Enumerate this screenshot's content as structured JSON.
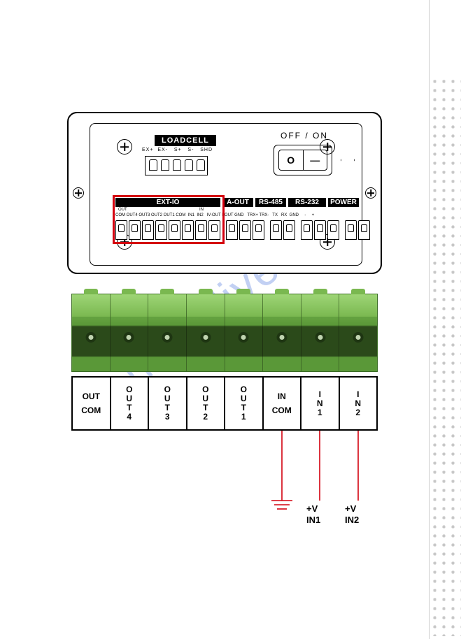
{
  "watermark": "manualslive.com",
  "device": {
    "loadcell_label": "LOADCELL",
    "loadcell_pins": "EX+  EX-   S+   S-   SHD",
    "off_on": "OFF  /  ON",
    "switch_o": "O",
    "switch_i": "—",
    "sections": {
      "extio": "EXT-IO",
      "aout": "A-OUT",
      "rs485": "RS-485",
      "rs232": "RS-232",
      "power": "POWER"
    },
    "extio_out": "OUT",
    "extio_in": "IN",
    "pin_row": "COM OUT4 OUT3 OUT2 OUT1 COM  IN1  IN2   IV-OUT I-OUT GND   TRX+ TRX-   TX   RX  GND     -     +"
  },
  "terminal_labels": [
    {
      "line1": "OUT",
      "line2": "COM",
      "vertical": false
    },
    {
      "text": "OUT4",
      "vertical": true
    },
    {
      "text": "OUT3",
      "vertical": true
    },
    {
      "text": "OUT2",
      "vertical": true
    },
    {
      "text": "OUT1",
      "vertical": true
    },
    {
      "line1": "IN",
      "line2": "COM",
      "vertical": false
    },
    {
      "text": "IN1",
      "vertical": true
    },
    {
      "text": "IN2",
      "vertical": true
    }
  ],
  "wiring_labels": {
    "v1": "+V\nIN1",
    "v2": "+V\nIN2"
  }
}
